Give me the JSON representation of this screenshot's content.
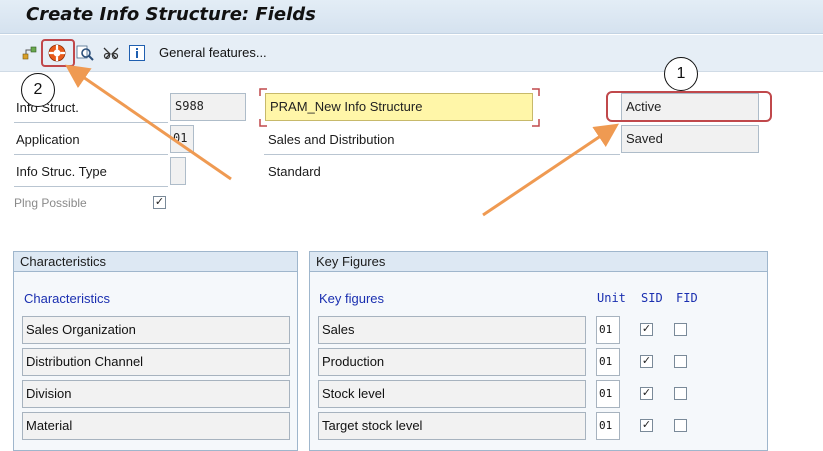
{
  "title": "Create Info Structure: Fields",
  "toolbar": {
    "general_features_label": "General features...",
    "icons": [
      "hierarchy-icon",
      "lifebuoy-icon",
      "find-icon",
      "glasses-icon",
      "info-icon"
    ]
  },
  "form": {
    "info_struct_label": "Info Struct.",
    "info_struct_value": "S988",
    "info_struct_desc": "PRAM_New Info Structure",
    "application_label": "Application",
    "application_value": "01",
    "application_desc": "Sales and Distribution",
    "info_struc_type_label": "Info Struc. Type",
    "info_struc_type_value": "",
    "info_struc_type_desc": "Standard",
    "plng_possible_label": "Plng Possible",
    "plng_possible_checked": true,
    "status_active": "Active",
    "status_saved": "Saved"
  },
  "characteristics": {
    "header": "Characteristics",
    "column_label": "Characteristics",
    "rows": [
      "Sales Organization",
      "Distribution Channel",
      "Division",
      "Material"
    ]
  },
  "key_figures": {
    "header": "Key Figures",
    "column_label": "Key figures",
    "unit_label": "Unit",
    "sid_label": "SID",
    "fid_label": "FID",
    "rows": [
      {
        "name": "Sales",
        "unit": "01",
        "sid": true,
        "fid": false
      },
      {
        "name": "Production",
        "unit": "01",
        "sid": true,
        "fid": false
      },
      {
        "name": "Stock level",
        "unit": "01",
        "sid": true,
        "fid": false
      },
      {
        "name": "Target stock level",
        "unit": "01",
        "sid": true,
        "fid": false
      }
    ]
  },
  "annotations": {
    "callout_1": "1",
    "callout_2": "2"
  },
  "colors": {
    "accent_blue": "#1a2fb0",
    "highlight_red": "#c0484b",
    "arrow_orange": "#ef9a52",
    "input_yellow": "#fff6a8"
  }
}
